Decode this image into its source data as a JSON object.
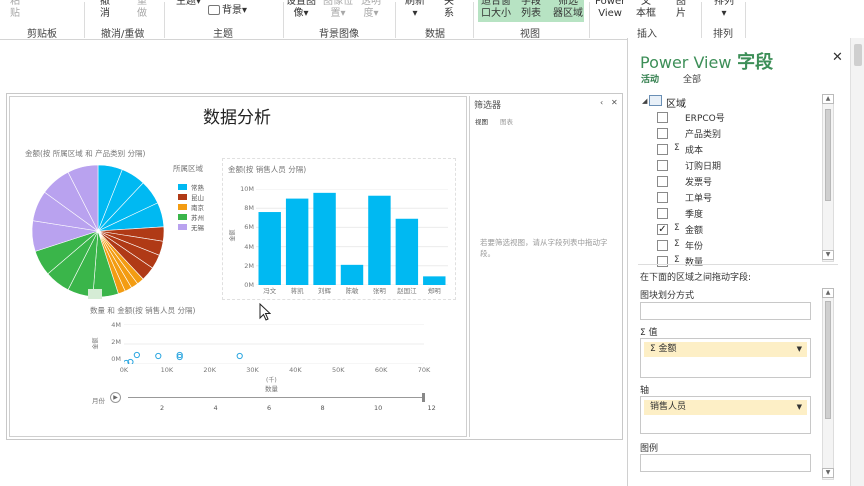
{
  "ribbon": {
    "buttons": [
      {
        "id": "paste",
        "label": "粘\n贴",
        "dim": true
      },
      {
        "id": "undo",
        "label": "撤\n消"
      },
      {
        "id": "redo",
        "label": "重\n做",
        "dim": true
      },
      {
        "id": "theme",
        "label": "主题▾"
      },
      {
        "id": "background",
        "label": "背景▾"
      },
      {
        "id": "set-image",
        "label": "设置图\n像▾"
      },
      {
        "id": "image-position",
        "label": "图像位\n置▾",
        "dim": true
      },
      {
        "id": "transparency",
        "label": "透明\n度▾",
        "dim": true
      },
      {
        "id": "refresh",
        "label": "刷新\n▾"
      },
      {
        "id": "relationships",
        "label": "关\n系"
      },
      {
        "id": "fit-window",
        "label": "适合窗\n口大小"
      },
      {
        "id": "field-list",
        "label": "字段\n列表"
      },
      {
        "id": "filter-area",
        "label": "筛选\n器区域"
      },
      {
        "id": "power-view",
        "label": "Power\nView"
      },
      {
        "id": "textbox",
        "label": "文\n本框"
      },
      {
        "id": "picture",
        "label": "图\n片"
      },
      {
        "id": "arrange",
        "label": "排列\n▾"
      }
    ],
    "groups": [
      "剪贴板",
      "撤消/重做",
      "主题",
      "背景图像",
      "数据",
      "视图",
      "插入",
      "排列"
    ]
  },
  "report": {
    "title": "数据分析",
    "pie": {
      "title": "金额(按 所属区域 和 产品类别 分隔)",
      "legend_title": "所属区域",
      "legend": [
        {
          "label": "常熟",
          "color": "#00b9f2"
        },
        {
          "label": "昆山",
          "color": "#b03a16"
        },
        {
          "label": "南京",
          "color": "#f39c12"
        },
        {
          "label": "苏州",
          "color": "#3ab54a"
        },
        {
          "label": "无锡",
          "color": "#b9a2ef"
        }
      ]
    },
    "bar": {
      "title": "金额(按 销售人员 分隔)",
      "ylabel": "金额",
      "yticks": [
        "10M",
        "8M",
        "6M",
        "4M",
        "2M",
        "0M"
      ],
      "categories": [
        "冯文",
        "蒋凯",
        "刘辉",
        "陈敏",
        "张明",
        "赵国江",
        "郑明"
      ],
      "values": [
        7.6,
        9.0,
        9.6,
        2.1,
        9.3,
        6.9,
        0.9
      ],
      "ylim": [
        0,
        10
      ],
      "color": "#00b9f2"
    },
    "scatter": {
      "title": "数量 和 金额(按 销售人员 分隔)",
      "ylabel": "金额",
      "yticks": [
        "4M",
        "2M",
        "0M"
      ],
      "xticks": [
        "0K",
        "10K",
        "20K",
        "30K",
        "40K",
        "50K",
        "60K",
        "70K"
      ],
      "xlabel": "数量",
      "xunit": "(千)",
      "play_label": "月份",
      "slider_ticks": [
        "2",
        "4",
        "6",
        "8",
        "10",
        "12"
      ]
    },
    "filter": {
      "title": "筛选器",
      "tabs": [
        "视图",
        "图表"
      ],
      "message": "若要筛选视图，请从字段列表中拖动字段。"
    }
  },
  "fieldpane": {
    "title_prefix": "Power View",
    "title_suffix": "字段",
    "tabs": [
      "活动",
      "全部"
    ],
    "table": "区域",
    "fields": [
      {
        "label": "ERPCO号",
        "checked": false,
        "sigma": false
      },
      {
        "label": "产品类别",
        "checked": false,
        "sigma": false
      },
      {
        "label": "成本",
        "checked": false,
        "sigma": true
      },
      {
        "label": "订购日期",
        "checked": false,
        "sigma": false
      },
      {
        "label": "发票号",
        "checked": false,
        "sigma": false
      },
      {
        "label": "工单号",
        "checked": false,
        "sigma": false
      },
      {
        "label": "季度",
        "checked": false,
        "sigma": false
      },
      {
        "label": "金额",
        "checked": true,
        "sigma": true
      },
      {
        "label": "年份",
        "checked": false,
        "sigma": true
      },
      {
        "label": "数量",
        "checked": false,
        "sigma": true
      }
    ],
    "drag_hint": "在下面的区域之间拖动字段:",
    "tile_by": "图块划分方式",
    "values_label": "Σ 值",
    "values_chip": "Σ 金额",
    "axis_label": "轴",
    "axis_chip": "销售人员",
    "legend_label": "图例"
  }
}
